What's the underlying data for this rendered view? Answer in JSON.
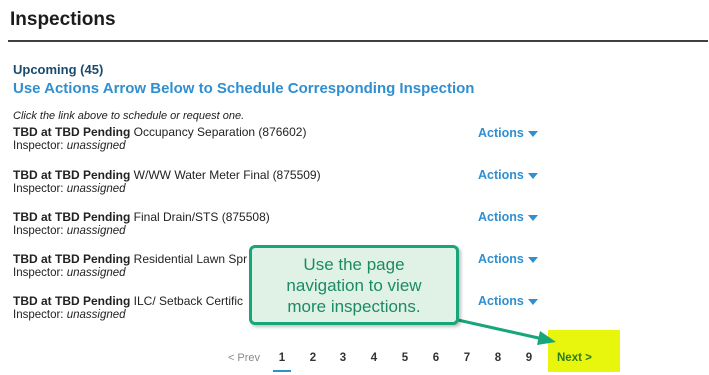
{
  "header": {
    "title": "Inspections"
  },
  "section": {
    "count_label": "Upcoming (45)",
    "schedule_link": "Use Actions Arrow Below to Schedule Corresponding Inspection",
    "hint": "Click the link above to schedule or request one."
  },
  "inspections": [
    {
      "location": "TBD at TBD Pending",
      "name": "Occupancy Separation (876602)",
      "inspector_label": "Inspector:",
      "inspector": "unassigned",
      "actions": "Actions"
    },
    {
      "location": "TBD at TBD Pending",
      "name": "W/WW Water Meter Final (875509)",
      "inspector_label": "Inspector:",
      "inspector": "unassigned",
      "actions": "Actions"
    },
    {
      "location": "TBD at TBD Pending",
      "name": "Final Drain/STS (875508)",
      "inspector_label": "Inspector:",
      "inspector": "unassigned",
      "actions": "Actions"
    },
    {
      "location": "TBD at TBD Pending",
      "name": "Residential Lawn Spr",
      "inspector_label": "Inspector:",
      "inspector": "unassigned",
      "actions": "Actions"
    },
    {
      "location": "TBD at TBD Pending",
      "name": "ILC/ Setback Certific",
      "inspector_label": "Inspector:",
      "inspector": "unassigned",
      "actions": "Actions"
    }
  ],
  "pagination": {
    "prev": "< Prev",
    "pages": [
      "1",
      "2",
      "3",
      "4",
      "5",
      "6",
      "7",
      "8",
      "9"
    ],
    "current_page": "1",
    "next": "Next >"
  },
  "callout": {
    "lines": [
      "Use the page",
      "navigation to view",
      "more inspections."
    ]
  },
  "colors": {
    "link": "#2f8fd0",
    "callout_border": "#17a57a",
    "callout_fill": "#e0f2e6",
    "next_highlight": "#e8f50c"
  }
}
